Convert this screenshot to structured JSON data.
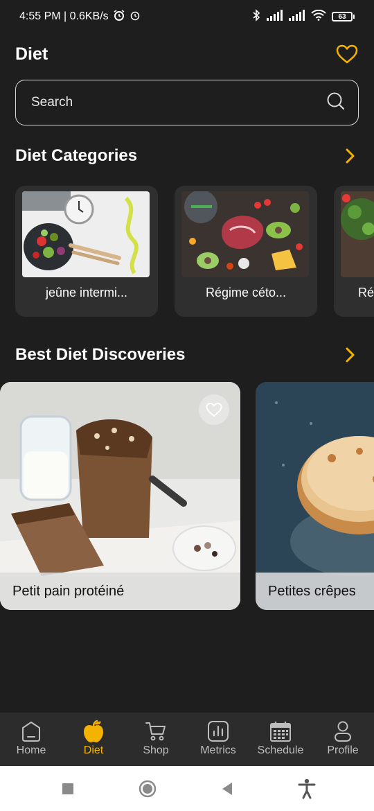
{
  "status_bar": {
    "time_speed": "4:55 PM | 0.6KB/s",
    "battery": "63",
    "icons": [
      "alarm-icon",
      "clock-icon",
      "bluetooth-icon",
      "signal-icon",
      "signal-icon",
      "wifi-icon",
      "battery-icon"
    ]
  },
  "header": {
    "title": "Diet",
    "heart_icon": "heart-icon"
  },
  "search": {
    "placeholder": "Search",
    "icon": "search-icon"
  },
  "categories_section": {
    "title": "Diet Categories",
    "items": [
      {
        "label": "jeûne intermi..."
      },
      {
        "label": "Régime céto..."
      },
      {
        "label": "Ré"
      }
    ]
  },
  "discoveries_section": {
    "title": "Best Diet Discoveries",
    "items": [
      {
        "label": "Petit pain protéiné"
      },
      {
        "label": "Petites crêpes"
      }
    ]
  },
  "bottom_nav": {
    "items": [
      {
        "label": "Home",
        "icon": "home-icon"
      },
      {
        "label": "Diet",
        "icon": "apple-icon",
        "active": true
      },
      {
        "label": "Shop",
        "icon": "cart-icon"
      },
      {
        "label": "Metrics",
        "icon": "chart-icon"
      },
      {
        "label": "Schedule",
        "icon": "calendar-icon"
      },
      {
        "label": "Profile",
        "icon": "profile-icon"
      }
    ]
  },
  "colors": {
    "background": "#1e1e1e",
    "accent": "#f5b301",
    "card": "#2f2f2f",
    "nav_bg": "#2c2c2c"
  }
}
